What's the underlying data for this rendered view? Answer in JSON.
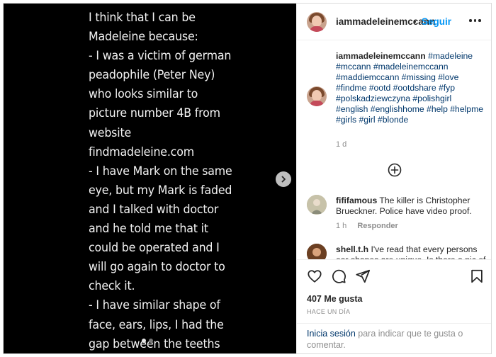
{
  "media": {
    "lines": [
      "I think that I can be",
      "Madeleine because:",
      "- I was a victim of german",
      "peadophile (Peter Ney)",
      "who looks similar to",
      "picture number 4B from",
      "website",
      "findmadeleine.com",
      "- I have Mark on the same",
      "eye, but my Mark is faded",
      "and I talked with doctor",
      "and he told me that it",
      "could be operated and I",
      "will go again to doctor to",
      "check it.",
      "- I have similar shape of",
      "face, ears, lips, I had the",
      "gap between the teeths"
    ],
    "next_icon": "chevron-right-icon"
  },
  "header": {
    "username": "iammadeleinemccann",
    "separator": "•",
    "follow_label": "Seguir",
    "more_icon": "more-options-icon"
  },
  "caption": {
    "username": "iammadeleinemccann",
    "hashtags": "#madeleine #mccann #madeleinemccann #maddiemccann #missing #love #findme #ootd #ootdshare #fyp #polskadziewczyna #polishgirl #english #englishhome #help #helpme #girls #girl #blonde",
    "time": "1 d"
  },
  "comments": [
    {
      "username": "fififamous",
      "text": "The killer is Christopher Brueckner. Police have video proof.",
      "time": "1 h",
      "reply_label": "Responder"
    },
    {
      "username": "shell.t.h",
      "text": "I've read that every persons ear shapes are unique. Is there a pic of"
    }
  ],
  "actions": {
    "likes": "407 Me gusta",
    "ago": "HACE UN DÍA"
  },
  "login_prompt": {
    "link": "Inicia sesión",
    "rest": " para indicar que te gusta o comentar."
  },
  "colors": {
    "accent": "#0095f6",
    "link": "#00376b",
    "muted": "#8e8e8e"
  }
}
